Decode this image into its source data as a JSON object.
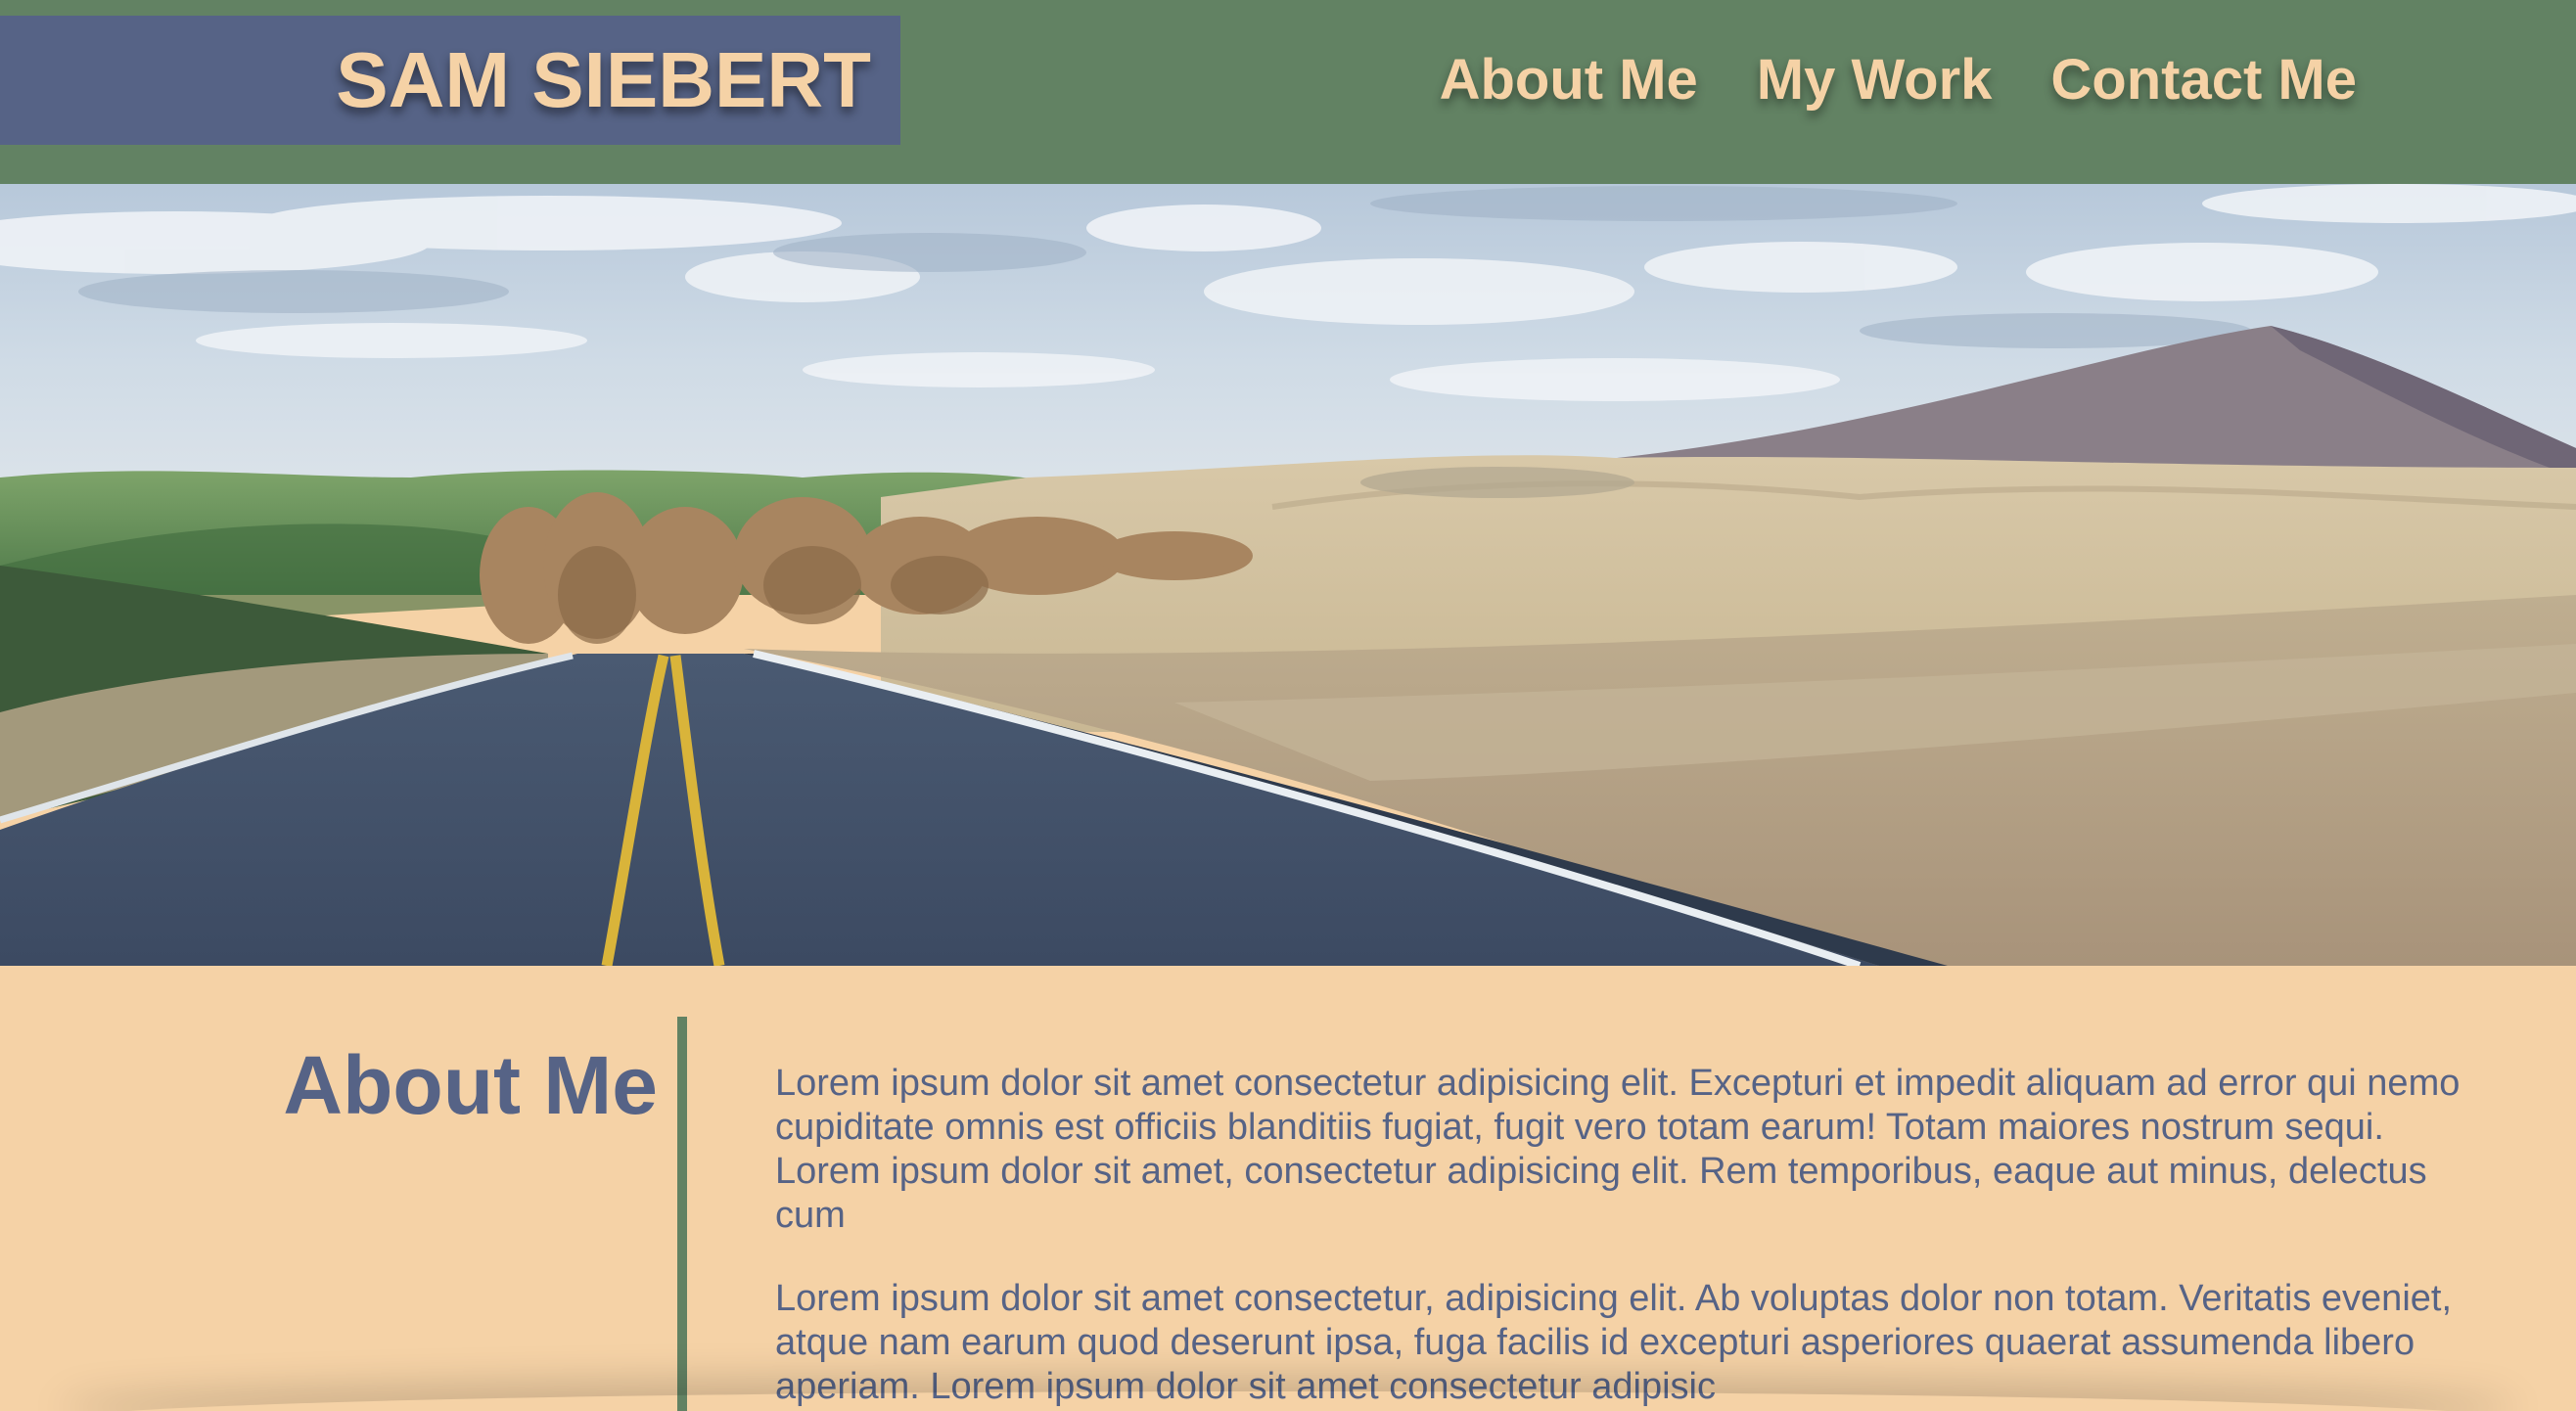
{
  "colors": {
    "header_bg": "#628263",
    "brand_bg": "#566386",
    "accent_text": "#f5d2a6",
    "page_bg": "#f5d2a6",
    "body_text": "#566386",
    "divider": "#628263"
  },
  "header": {
    "brand_name": "SAM SIEBERT",
    "nav": [
      {
        "label": "About Me"
      },
      {
        "label": "My Work"
      },
      {
        "label": "Contact Me"
      }
    ]
  },
  "about": {
    "title": "About Me",
    "paragraphs": [
      "Lorem ipsum dolor sit amet consectetur adipisicing elit. Excepturi et impedit aliquam ad error qui nemo cupiditate omnis est officiis blanditiis fugiat, fugit vero totam earum! Totam maiores nostrum sequi. Lorem ipsum dolor sit amet, consectetur adipisicing elit. Rem temporibus, eaque aut minus, delectus cum",
      "Lorem ipsum dolor sit amet consectetur, adipisicing elit. Ab voluptas dolor non totam. Veritatis eveniet, atque nam earum quod deserunt ipsa, fuga facilis id excepturi asperiores quaerat assumenda libero aperiam. Lorem ipsum dolor sit amet consectetur adipisic"
    ]
  }
}
